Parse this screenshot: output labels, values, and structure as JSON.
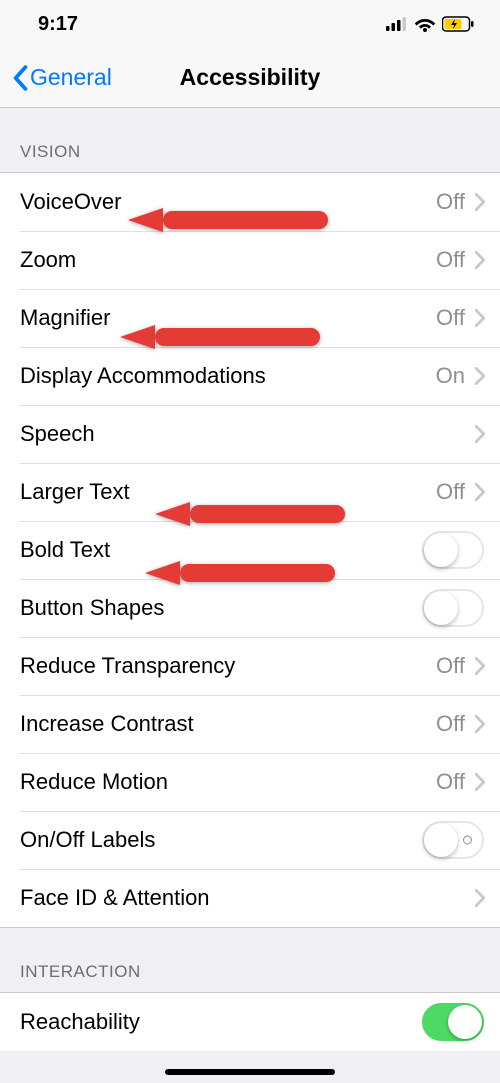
{
  "status": {
    "time": "9:17"
  },
  "nav": {
    "back_label": "General",
    "title": "Accessibility"
  },
  "sections": {
    "vision_header": "VISION",
    "interaction_header": "INTERACTION"
  },
  "rows": {
    "voiceover": {
      "label": "VoiceOver",
      "value": "Off"
    },
    "zoom": {
      "label": "Zoom",
      "value": "Off"
    },
    "magnifier": {
      "label": "Magnifier",
      "value": "Off"
    },
    "display_accommodations": {
      "label": "Display Accommodations",
      "value": "On"
    },
    "speech": {
      "label": "Speech"
    },
    "larger_text": {
      "label": "Larger Text",
      "value": "Off"
    },
    "bold_text": {
      "label": "Bold Text",
      "toggle": false
    },
    "button_shapes": {
      "label": "Button Shapes",
      "toggle": false
    },
    "reduce_transparency": {
      "label": "Reduce Transparency",
      "value": "Off"
    },
    "increase_contrast": {
      "label": "Increase Contrast",
      "value": "Off"
    },
    "reduce_motion": {
      "label": "Reduce Motion",
      "value": "Off"
    },
    "on_off_labels": {
      "label": "On/Off Labels",
      "toggle": false
    },
    "face_id_attention": {
      "label": "Face ID & Attention"
    },
    "reachability": {
      "label": "Reachability",
      "toggle": true
    }
  },
  "colors": {
    "link": "#007aff",
    "toggle_on": "#4cd964",
    "arrow": "#e43b37"
  }
}
